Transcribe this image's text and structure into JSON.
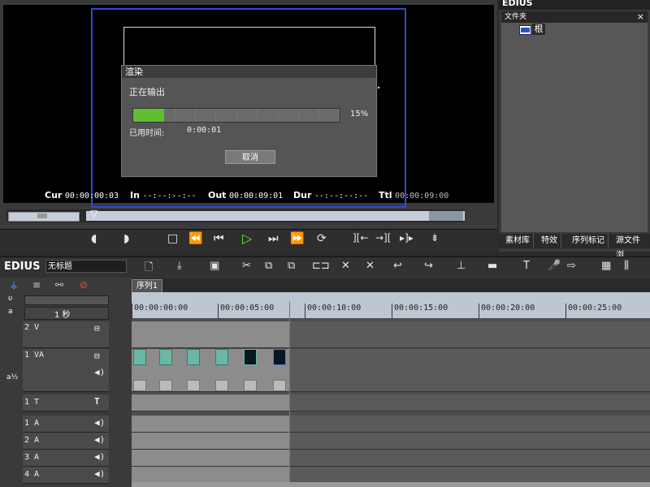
{
  "player": {
    "timecodes": [
      {
        "label": "Cur",
        "value": "00:00:00:03"
      },
      {
        "label": "In",
        "value": "--:--:--:--"
      },
      {
        "label": "Out",
        "value": "00:00:09:01"
      },
      {
        "label": "Dur",
        "value": "--:--:--:--"
      },
      {
        "label": "Ttl",
        "value": "00:00:09:00"
      }
    ],
    "transport_icons": [
      "mark-in-icon",
      "mark-out-icon",
      "stop-icon",
      "rewind-icon",
      "step-back-icon",
      "play-icon",
      "step-forward-icon",
      "fast-forward-icon",
      "loop-icon",
      "set-in-icon",
      "set-out-icon",
      "insert-icon",
      "overwrite-icon"
    ]
  },
  "dialog": {
    "title": "渲染",
    "status": "正在输出",
    "progress": 15,
    "progress_label": "15%",
    "elapsed_label": "已用时间:",
    "elapsed_value": "0:00:01",
    "cancel_label": "取消",
    "accent": "#5fbf30"
  },
  "bin": {
    "top_label": "EDIUS",
    "header": "文件夹",
    "close": "×",
    "root_label": "根",
    "tabs": [
      "素材库",
      "特效",
      "序列标记",
      "源文件浏"
    ]
  },
  "timeline": {
    "logo": "EDIUS",
    "project_name": "无标题",
    "sequence_tab": "序列1",
    "scale_label": "1 秒",
    "ruler_labels": [
      "00:00:00:00",
      "00:00:05:00",
      "00:00:10:00",
      "00:00:15:00",
      "00:00:20:00",
      "00:00:25:00"
    ],
    "tracks": [
      {
        "name": "2 V"
      },
      {
        "name": "1 VA"
      },
      {
        "name": "1 T"
      },
      {
        "name": "1 A"
      },
      {
        "name": "2 A"
      },
      {
        "name": "3 A"
      },
      {
        "name": "4 A"
      }
    ]
  }
}
